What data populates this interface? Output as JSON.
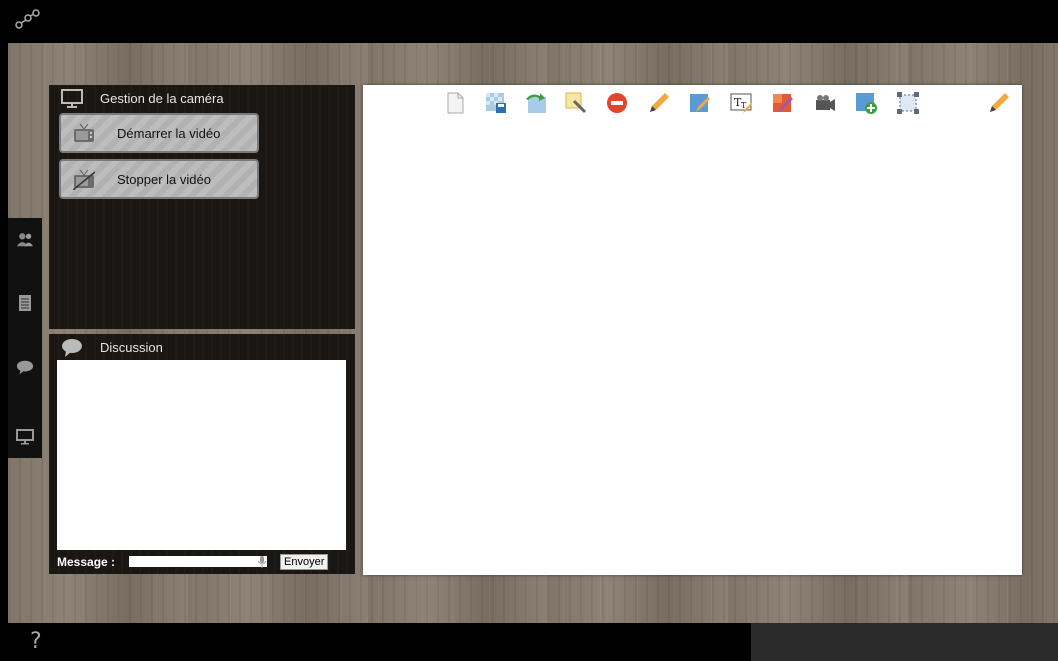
{
  "app": {
    "logo_icon": "share-nodes-icon"
  },
  "sidebar": {
    "items": [
      {
        "icon": "users-icon"
      },
      {
        "icon": "notepad-icon"
      },
      {
        "icon": "chat-bubble-icon"
      },
      {
        "icon": "monitor-icon"
      }
    ]
  },
  "camera_panel": {
    "title": "Gestion de la caméra",
    "start_label": "Démarrer la vidéo",
    "stop_label": "Stopper la vidéo"
  },
  "chat_panel": {
    "title": "Discussion",
    "message_label": "Message :",
    "message_value": "",
    "send_label": "Envoyer"
  },
  "whiteboard": {
    "tools": [
      "new-page-icon",
      "save-icon",
      "redo-icon",
      "magic-wand-icon",
      "delete-icon",
      "pencil-icon",
      "edit-image-icon",
      "text-tool-icon",
      "color-fill-icon",
      "camera-icon",
      "add-page-icon",
      "select-region-icon"
    ],
    "right_tool": "pencil-icon"
  },
  "footer": {
    "help_label": "?"
  },
  "colors": {
    "toolbar_bg": "#000000",
    "panel_bg": "#1a1613",
    "wood": "#857b6e",
    "accent_red": "#e0452e"
  }
}
